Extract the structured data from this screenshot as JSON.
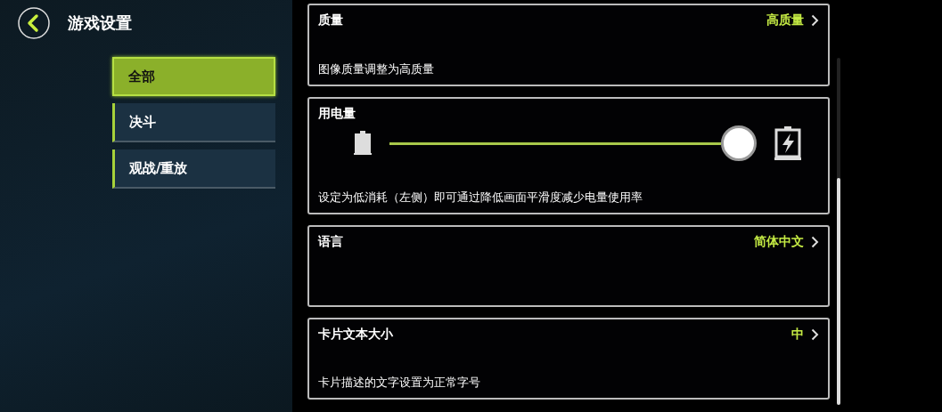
{
  "header": {
    "title": "游戏设置"
  },
  "sidebar": {
    "items": [
      {
        "label": "全部",
        "selected": true
      },
      {
        "label": "决斗",
        "selected": false
      },
      {
        "label": "观战/重放",
        "selected": false
      }
    ]
  },
  "settings": [
    {
      "kind": "select",
      "title": "质量",
      "value": "高质量",
      "description": "图像质量调整为高质量"
    },
    {
      "kind": "slider",
      "title": "用电量",
      "level": 1,
      "description": "设定为低消耗（左侧）即可通过降低画面平滑度减少电量使用率"
    },
    {
      "kind": "select",
      "title": "语言",
      "value": "简体中文"
    },
    {
      "kind": "select",
      "title": "卡片文本大小",
      "value": "中",
      "description": "卡片描述的文字设置为正常字号"
    }
  ]
}
